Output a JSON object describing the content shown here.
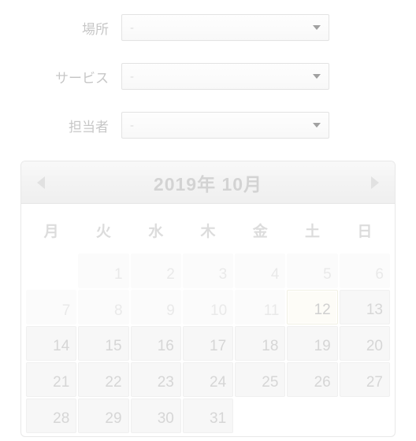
{
  "filters": {
    "location": {
      "label": "場所",
      "value": "-"
    },
    "service": {
      "label": "サービス",
      "value": "-"
    },
    "staff": {
      "label": "担当者",
      "value": "-"
    }
  },
  "calendar": {
    "title": "2019年 10月",
    "dow": [
      "月",
      "火",
      "水",
      "木",
      "金",
      "土",
      "日"
    ],
    "weeks": [
      [
        {
          "n": "",
          "k": "empty"
        },
        {
          "n": "1",
          "k": "past-month"
        },
        {
          "n": "2",
          "k": "past-month"
        },
        {
          "n": "3",
          "k": "past-month"
        },
        {
          "n": "4",
          "k": "past-month"
        },
        {
          "n": "5",
          "k": "past-month"
        },
        {
          "n": "6",
          "k": "past-month"
        }
      ],
      [
        {
          "n": "7",
          "k": "past-month"
        },
        {
          "n": "8",
          "k": "past-month"
        },
        {
          "n": "9",
          "k": "past-month"
        },
        {
          "n": "10",
          "k": "past-month"
        },
        {
          "n": "11",
          "k": "past-month"
        },
        {
          "n": "12",
          "k": "today"
        },
        {
          "n": "13",
          "k": "active"
        }
      ],
      [
        {
          "n": "14",
          "k": "active"
        },
        {
          "n": "15",
          "k": "active"
        },
        {
          "n": "16",
          "k": "active"
        },
        {
          "n": "17",
          "k": "active"
        },
        {
          "n": "18",
          "k": "active"
        },
        {
          "n": "19",
          "k": "active"
        },
        {
          "n": "20",
          "k": "active"
        }
      ],
      [
        {
          "n": "21",
          "k": "active"
        },
        {
          "n": "22",
          "k": "active"
        },
        {
          "n": "23",
          "k": "active"
        },
        {
          "n": "24",
          "k": "active"
        },
        {
          "n": "25",
          "k": "active"
        },
        {
          "n": "26",
          "k": "active"
        },
        {
          "n": "27",
          "k": "active"
        }
      ],
      [
        {
          "n": "28",
          "k": "active"
        },
        {
          "n": "29",
          "k": "active"
        },
        {
          "n": "30",
          "k": "active"
        },
        {
          "n": "31",
          "k": "active"
        },
        {
          "n": "",
          "k": "empty"
        },
        {
          "n": "",
          "k": "empty"
        },
        {
          "n": "",
          "k": "empty"
        }
      ]
    ]
  }
}
